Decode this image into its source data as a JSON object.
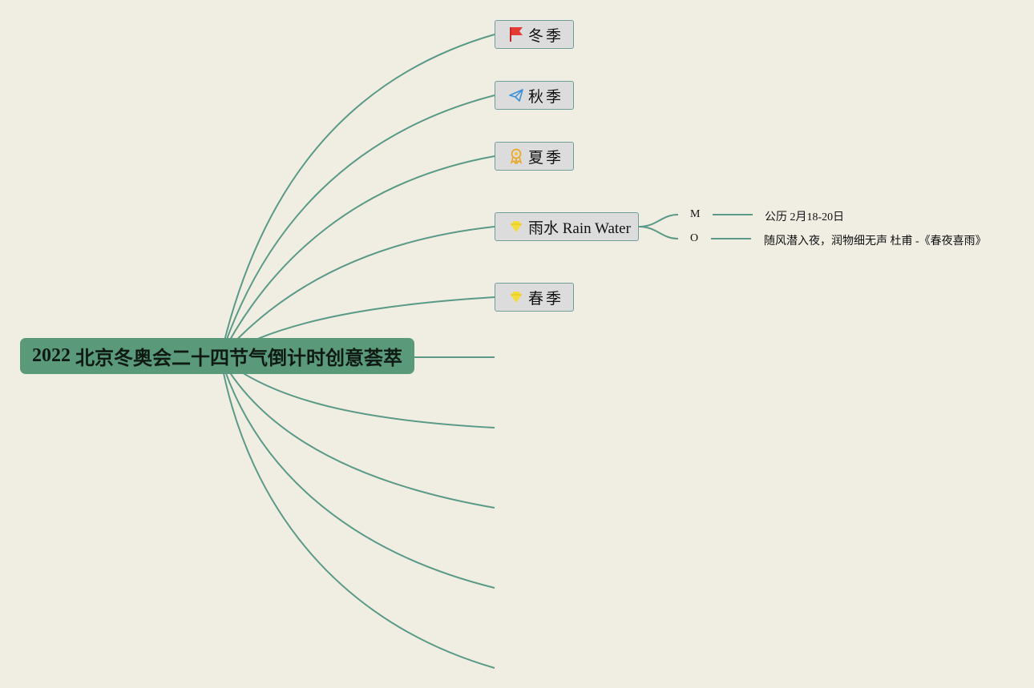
{
  "root": {
    "year": "2022",
    "title": "北京冬奥会二十四节气倒计时创意荟萃"
  },
  "branches": [
    {
      "label": "冬季",
      "icon": "red-flag-icon"
    },
    {
      "label": "秋季",
      "icon": "paper-plane-icon"
    },
    {
      "label": "夏季",
      "icon": "award-ribbon-icon"
    },
    {
      "label": "雨水 Rain Water",
      "icon": "diamond-icon"
    },
    {
      "label": "春季",
      "icon": "diamond-icon"
    }
  ],
  "rain_water_details": [
    {
      "key": "M",
      "value": "公历 2月18-20日"
    },
    {
      "key": "O",
      "value": "随风潜入夜，润物细无声 杜甫 -《春夜喜雨》"
    }
  ],
  "colors": {
    "background": "#f0ede3",
    "root_fill": "#5a9a7a",
    "connector": "#5a9a86",
    "node_fill": "#dcdcdc",
    "node_border": "#6e9f98"
  }
}
